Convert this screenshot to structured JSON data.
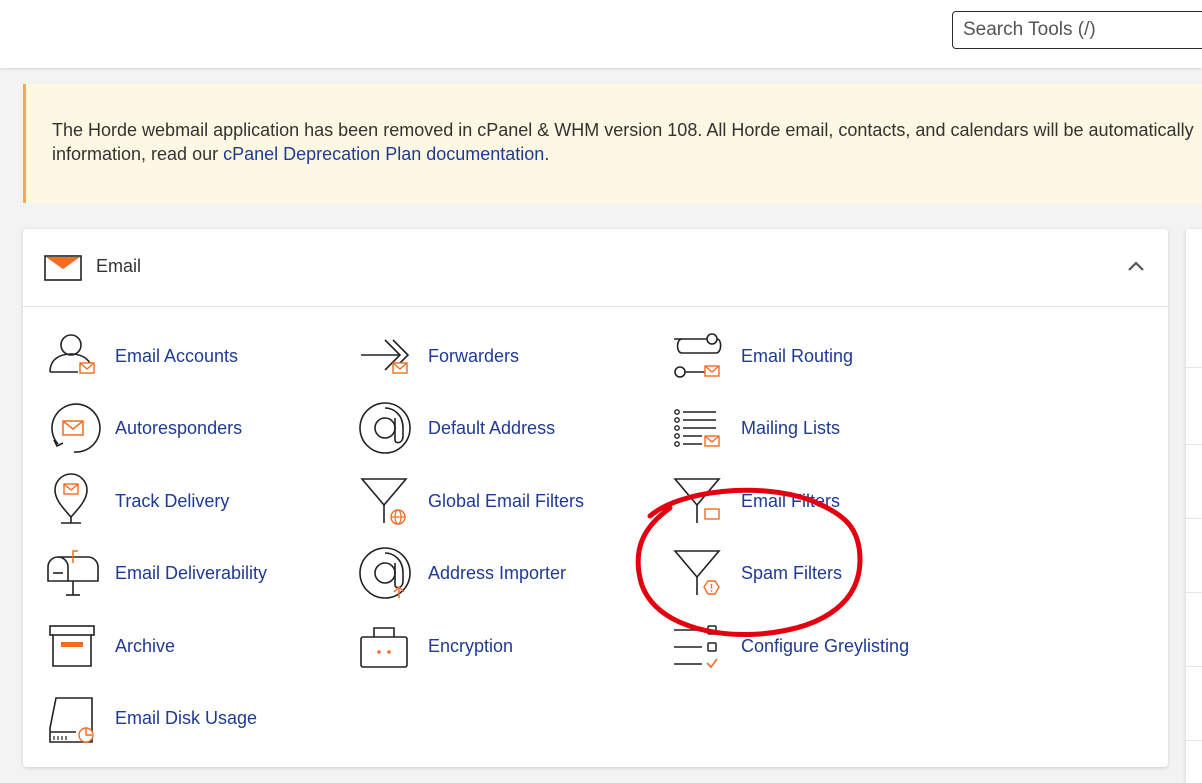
{
  "search": {
    "placeholder": "Search Tools (/)"
  },
  "notice": {
    "text_line1": "The Horde webmail application has been removed in cPanel & WHM version 108. All Horde email, contacts, and calendars will be automatically",
    "text_line2_prefix": "information, read our ",
    "link_text": "cPanel Deprecation Plan documentation",
    "text_line2_suffix": "."
  },
  "email_section": {
    "title": "Email",
    "tools": [
      {
        "label": "Email Accounts",
        "icon": "user-email-icon"
      },
      {
        "label": "Forwarders",
        "icon": "forward-arrow-icon"
      },
      {
        "label": "Email Routing",
        "icon": "routing-icon"
      },
      {
        "label": "Autoresponders",
        "icon": "autoresponder-icon"
      },
      {
        "label": "Default Address",
        "icon": "at-sign-icon"
      },
      {
        "label": "Mailing Lists",
        "icon": "list-email-icon"
      },
      {
        "label": "Track Delivery",
        "icon": "map-pin-email-icon"
      },
      {
        "label": "Global Email Filters",
        "icon": "funnel-globe-icon"
      },
      {
        "label": "Email Filters",
        "icon": "funnel-icon"
      },
      {
        "label": "Email Deliverability",
        "icon": "mailbox-icon"
      },
      {
        "label": "Address Importer",
        "icon": "at-import-icon"
      },
      {
        "label": "Spam Filters",
        "icon": "funnel-warning-icon"
      },
      {
        "label": "Archive",
        "icon": "archive-box-icon"
      },
      {
        "label": "Encryption",
        "icon": "encryption-case-icon"
      },
      {
        "label": "Configure Greylisting",
        "icon": "checklist-icon"
      },
      {
        "label": "Email Disk Usage",
        "icon": "disk-usage-icon"
      }
    ]
  },
  "colors": {
    "accent": "#f26c22",
    "link": "#1f3a93",
    "annotation": "#e3000f",
    "notice_bg": "#fcf8e3"
  }
}
